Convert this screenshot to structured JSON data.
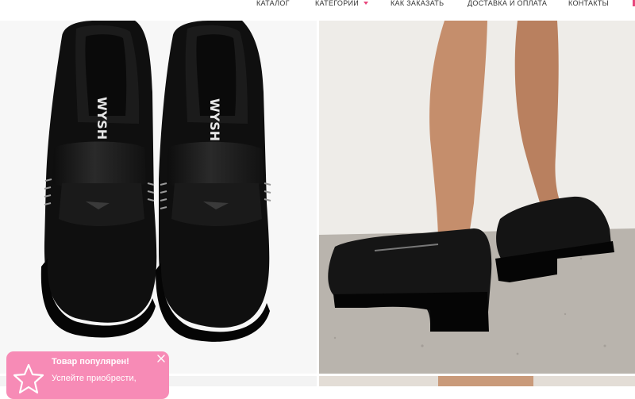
{
  "nav": {
    "items": [
      {
        "label": "КАТАЛОГ"
      },
      {
        "label": "КАТЕГОРИИ",
        "has_dropdown": true
      },
      {
        "label": "КАК ЗАКАЗАТЬ"
      },
      {
        "label": "ДОСТАВКА И ОПЛАТА"
      },
      {
        "label": "КОНТАКТЫ"
      }
    ],
    "accent_color": "#e8467c"
  },
  "gallery": {
    "photos": [
      {
        "icon": "product-photo-top-view",
        "brand_mark": "WYSH"
      },
      {
        "icon": "product-photo-on-feet"
      },
      {
        "icon": "product-photo"
      },
      {
        "icon": "product-photo"
      }
    ]
  },
  "toast": {
    "title": "Товар популярен!",
    "text": "Успейте приобрести,",
    "icon": "star-icon",
    "close_icon": "close-icon",
    "background": "#f78bb6"
  }
}
